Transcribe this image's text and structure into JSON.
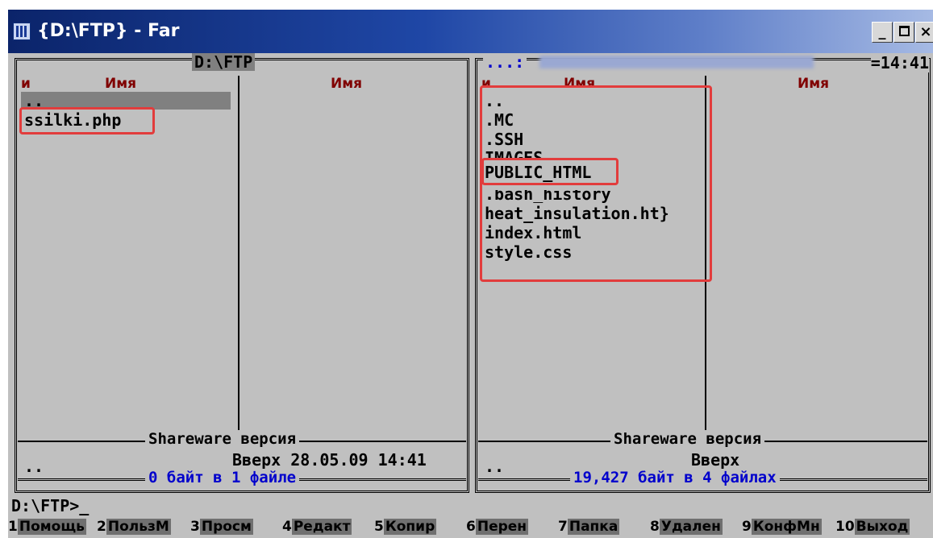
{
  "window": {
    "title": "{D:\\FTP} - Far",
    "icon": "far-manager-icon",
    "buttons": {
      "minimize": "_",
      "close": "×"
    }
  },
  "left_panel": {
    "title": "D:\\FTP",
    "col1_header_prefix": "и",
    "col1_header": "Имя",
    "col2_header": "Имя",
    "cursor_item": "..",
    "files": [
      "ssilki.php"
    ],
    "footer_label": "Shareware версия",
    "status_name": "..",
    "status_info": "Вверх 28.05.09 14:41",
    "summary": "0 байт в 1 файле"
  },
  "right_panel": {
    "title_prefix": "...:",
    "clock": "=14:41",
    "col1_header_prefix": "и",
    "col1_header": "Имя",
    "col2_header": "Имя",
    "files": [
      "..",
      ".MC",
      ".SSH",
      "IMAGES",
      "PUBLIC_HTML",
      ".bash_history",
      "heat_insulation.ht}",
      "index.html",
      "style.css"
    ],
    "footer_label": "Shareware версия",
    "status_name": "..",
    "status_info": "Вверх",
    "summary": "19,427 байт в 4 файлах"
  },
  "command_line": "D:\\FTP>_",
  "keybar": [
    {
      "num": "1",
      "label": "Помощь"
    },
    {
      "num": "2",
      "label": "ПользМ"
    },
    {
      "num": "3",
      "label": "Просм"
    },
    {
      "num": "4",
      "label": "Редакт"
    },
    {
      "num": "5",
      "label": "Копир"
    },
    {
      "num": "6",
      "label": "Перен"
    },
    {
      "num": "7",
      "label": "Папка"
    },
    {
      "num": "8",
      "label": "Удален"
    },
    {
      "num": "9",
      "label": "КонфМн"
    },
    {
      "num": "10",
      "label": "Выход"
    }
  ],
  "colors": {
    "background": "#c0c0c0",
    "header_text": "#800000",
    "summary_text": "#0000cc",
    "highlight": "#e23c3c",
    "cursor": "#808080"
  }
}
